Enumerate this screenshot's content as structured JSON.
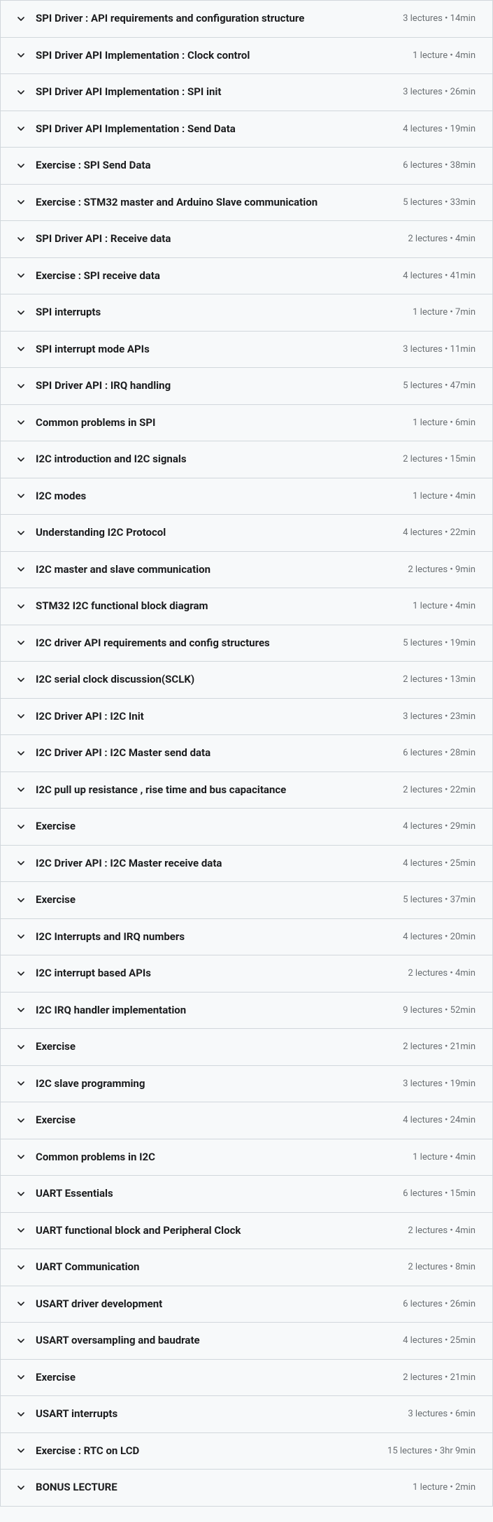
{
  "sections": [
    {
      "title": "SPI Driver : API requirements and configuration structure",
      "meta": "3 lectures • 14min"
    },
    {
      "title": "SPI Driver API Implementation : Clock control",
      "meta": "1 lecture • 4min"
    },
    {
      "title": "SPI Driver API Implementation : SPI init",
      "meta": "3 lectures • 26min"
    },
    {
      "title": "SPI Driver API Implementation : Send Data",
      "meta": "4 lectures • 19min"
    },
    {
      "title": "Exercise : SPI Send Data",
      "meta": "6 lectures • 38min"
    },
    {
      "title": "Exercise : STM32 master and Arduino Slave communication",
      "meta": "5 lectures • 33min"
    },
    {
      "title": "SPI Driver API : Receive data",
      "meta": "2 lectures • 4min"
    },
    {
      "title": "Exercise : SPI receive data",
      "meta": "4 lectures • 41min"
    },
    {
      "title": "SPI interrupts",
      "meta": "1 lecture • 7min"
    },
    {
      "title": "SPI interrupt mode APIs",
      "meta": "3 lectures • 11min"
    },
    {
      "title": "SPI Driver API : IRQ handling",
      "meta": "5 lectures • 47min"
    },
    {
      "title": "Common problems in SPI",
      "meta": "1 lecture • 6min"
    },
    {
      "title": "I2C introduction and I2C signals",
      "meta": "2 lectures • 15min"
    },
    {
      "title": "I2C modes",
      "meta": "1 lecture • 4min"
    },
    {
      "title": "Understanding I2C Protocol",
      "meta": "4 lectures • 22min"
    },
    {
      "title": "I2C master and slave communication",
      "meta": "2 lectures • 9min"
    },
    {
      "title": "STM32 I2C functional block diagram",
      "meta": "1 lecture • 4min"
    },
    {
      "title": "I2C driver API requirements and config structures",
      "meta": "5 lectures • 19min"
    },
    {
      "title": "I2C serial clock discussion(SCLK)",
      "meta": "2 lectures • 13min"
    },
    {
      "title": "I2C Driver API : I2C Init",
      "meta": "3 lectures • 23min"
    },
    {
      "title": "I2C Driver API : I2C Master send data",
      "meta": "6 lectures • 28min"
    },
    {
      "title": "I2C pull up resistance , rise time and bus capacitance",
      "meta": "2 lectures • 22min"
    },
    {
      "title": "Exercise",
      "meta": "4 lectures • 29min"
    },
    {
      "title": "I2C Driver API : I2C Master receive data",
      "meta": "4 lectures • 25min"
    },
    {
      "title": "Exercise",
      "meta": "5 lectures • 37min"
    },
    {
      "title": "I2C Interrupts and IRQ numbers",
      "meta": "4 lectures • 20min"
    },
    {
      "title": "I2C interrupt based APIs",
      "meta": "2 lectures • 4min"
    },
    {
      "title": "I2C IRQ handler implementation",
      "meta": "9 lectures • 52min"
    },
    {
      "title": "Exercise",
      "meta": "2 lectures • 21min"
    },
    {
      "title": "I2C slave programming",
      "meta": "3 lectures • 19min"
    },
    {
      "title": "Exercise",
      "meta": "4 lectures • 24min"
    },
    {
      "title": "Common problems in I2C",
      "meta": "1 lecture • 4min"
    },
    {
      "title": "UART Essentials",
      "meta": "6 lectures • 15min"
    },
    {
      "title": "UART functional block and Peripheral Clock",
      "meta": "2 lectures • 4min"
    },
    {
      "title": "UART Communication",
      "meta": "2 lectures • 8min"
    },
    {
      "title": "USART driver development",
      "meta": "6 lectures • 26min"
    },
    {
      "title": "USART oversampling and baudrate",
      "meta": "4 lectures • 25min"
    },
    {
      "title": "Exercise",
      "meta": "2 lectures • 21min"
    },
    {
      "title": "USART interrupts",
      "meta": "3 lectures • 6min"
    },
    {
      "title": "Exercise : RTC on LCD",
      "meta": "15 lectures • 3hr 9min"
    },
    {
      "title": "BONUS LECTURE",
      "meta": "1 lecture • 2min"
    }
  ]
}
